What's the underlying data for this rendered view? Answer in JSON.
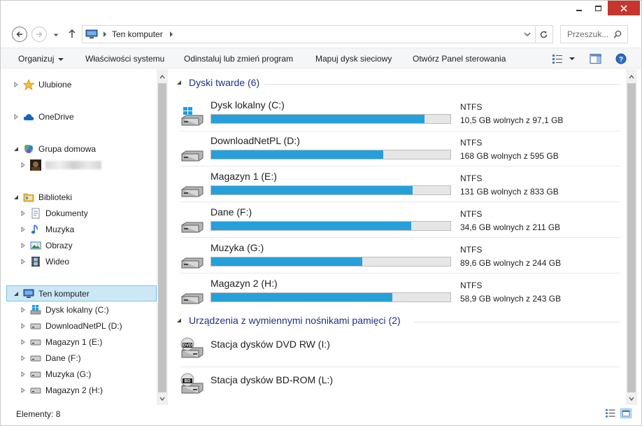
{
  "window": {
    "controls": {
      "minimize": "minimize",
      "maximize": "maximize",
      "close": "close"
    }
  },
  "address": {
    "path": "Ten komputer",
    "search_placeholder": "Przeszuk..."
  },
  "toolbar": {
    "organize": "Organizuj",
    "system_props": "Właściwości systemu",
    "uninstall": "Odinstaluj lub zmień program",
    "map_drive": "Mapuj dysk sieciowy",
    "control_panel": "Otwórz Panel sterowania"
  },
  "nav": {
    "favorites": "Ulubione",
    "onedrive": "OneDrive",
    "homegroup": "Grupa domowa",
    "libraries": "Biblioteki",
    "documents": "Dokumenty",
    "music": "Muzyka",
    "pictures": "Obrazy",
    "video": "Wideo",
    "this_pc": "Ten komputer",
    "drives": [
      "Dysk lokalny (C:)",
      "DownloadNetPL (D:)",
      "Magazyn 1 (E:)",
      "Dane (F:)",
      "Muzyka (G:)",
      "Magazyn 2 (H:)"
    ]
  },
  "content": {
    "hard_drives_title": "Dyski twarde (6)",
    "removable_title": "Urządzenia z wymiennymi nośnikami pamięci (2)",
    "drives": [
      {
        "name": "Dysk lokalny (C:)",
        "fs": "NTFS",
        "free": "10,5 GB wolnych z 97,1 GB",
        "used_fraction": 0.892
      },
      {
        "name": "DownloadNetPL (D:)",
        "fs": "NTFS",
        "free": "168 GB wolnych z 595 GB",
        "used_fraction": 0.718
      },
      {
        "name": "Magazyn 1 (E:)",
        "fs": "NTFS",
        "free": "131 GB wolnych z 833 GB",
        "used_fraction": 0.843
      },
      {
        "name": "Dane (F:)",
        "fs": "NTFS",
        "free": "34,6 GB wolnych z 211 GB",
        "used_fraction": 0.836
      },
      {
        "name": "Muzyka (G:)",
        "fs": "NTFS",
        "free": "89,6 GB wolnych z 244 GB",
        "used_fraction": 0.633
      },
      {
        "name": "Magazyn 2 (H:)",
        "fs": "NTFS",
        "free": "58,9 GB wolnych z 243 GB",
        "used_fraction": 0.758
      }
    ],
    "removable": [
      {
        "name": "Stacja dysków DVD RW (I:)",
        "badge": "DVD"
      },
      {
        "name": "Stacja dysków BD-ROM (L:)",
        "badge": "BD"
      }
    ]
  },
  "status": {
    "items": "Elementy: 8"
  },
  "colors": {
    "usage_bar": "#26a0da",
    "group_title": "#1e3287",
    "selection": "#cce8f7",
    "close_button": "#c7362d"
  }
}
